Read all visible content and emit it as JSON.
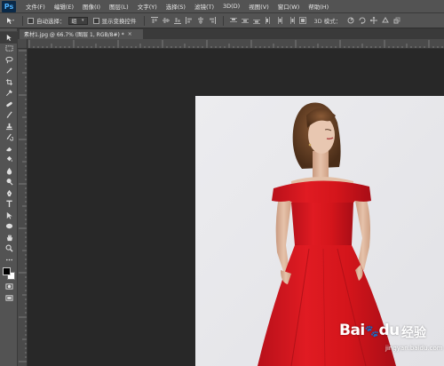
{
  "app": {
    "logo": "Ps"
  },
  "menu": [
    "文件(F)",
    "编辑(E)",
    "图像(I)",
    "图层(L)",
    "文字(Y)",
    "选择(S)",
    "滤镜(T)",
    "3D(D)",
    "视图(V)",
    "窗口(W)",
    "帮助(H)"
  ],
  "options": {
    "auto_select_label": "自动选择：",
    "auto_select_value": "组",
    "show_transform_label": "显示变换控件",
    "mode_3d_label": "3D 模式："
  },
  "document_tab": {
    "title": "素材1.jpg @ 66.7% (图层 1, RGB/8#) *",
    "close": "×"
  },
  "watermark": {
    "brand": "Bai",
    "brand_suffix": "du",
    "cn": "经验",
    "url": "jingyan.baidu.com"
  },
  "colors": {
    "foreground": "#000000",
    "background": "#ffffff",
    "dress": "#d4151b",
    "backdrop": "#e9e9ec"
  },
  "tools": [
    "move-tool",
    "marquee-tool",
    "lasso-tool",
    "quick-select-tool",
    "crop-tool",
    "eyedropper-tool",
    "healing-brush-tool",
    "brush-tool",
    "clone-stamp-tool",
    "history-brush-tool",
    "eraser-tool",
    "gradient-tool",
    "blur-tool",
    "dodge-tool",
    "pen-tool",
    "type-tool",
    "path-select-tool",
    "shape-tool",
    "hand-tool",
    "zoom-tool",
    "more-tools"
  ]
}
